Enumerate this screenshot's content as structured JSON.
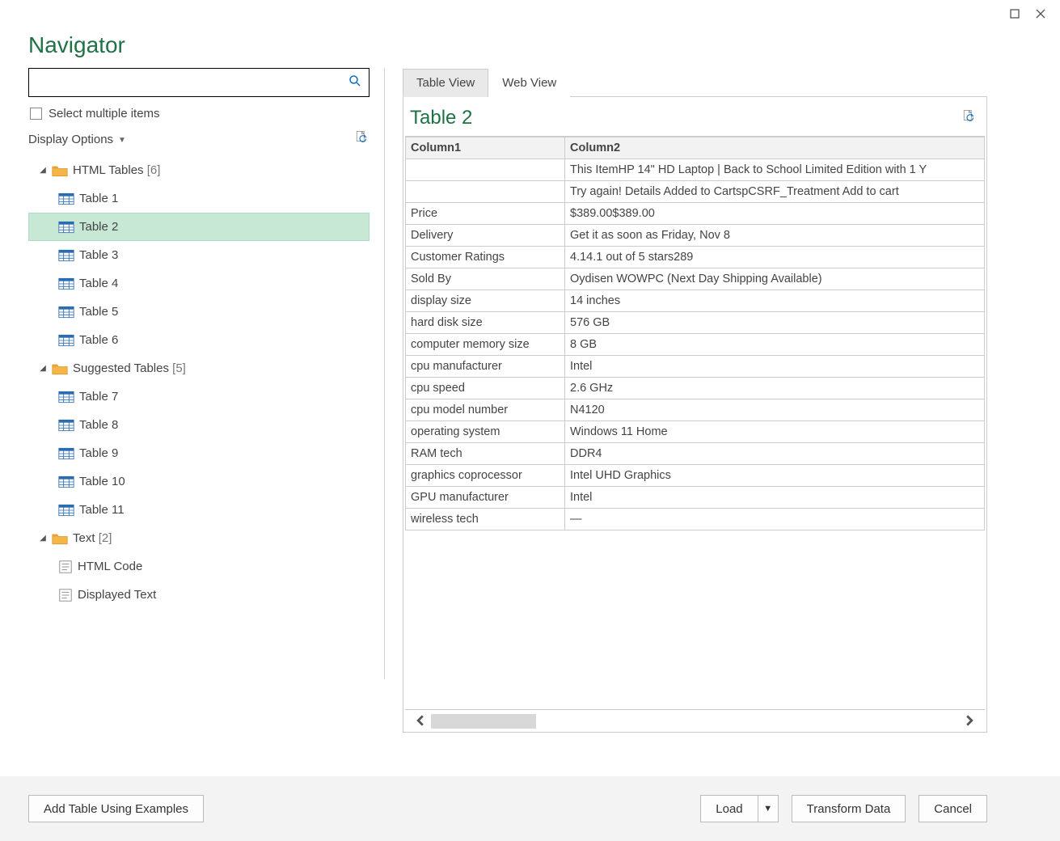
{
  "window": {
    "title": "Navigator"
  },
  "search": {
    "placeholder": ""
  },
  "select_multiple_label": "Select multiple items",
  "display_options_label": "Display Options",
  "tree": {
    "group1": {
      "label": "HTML Tables",
      "count": "[6]"
    },
    "g1items": [
      "Table 1",
      "Table 2",
      "Table 3",
      "Table 4",
      "Table 5",
      "Table 6"
    ],
    "group2": {
      "label": "Suggested Tables",
      "count": "[5]"
    },
    "g2items": [
      "Table 7",
      "Table 8",
      "Table 9",
      "Table 10",
      "Table 11"
    ],
    "group3": {
      "label": "Text",
      "count": "[2]"
    },
    "g3items": [
      "HTML Code",
      "Displayed Text"
    ],
    "selected": "Table 2"
  },
  "tabs": {
    "table_view": "Table View",
    "web_view": "Web View"
  },
  "preview": {
    "title": "Table 2",
    "headers": [
      "Column1",
      "Column2"
    ],
    "rows": [
      [
        "",
        "This ItemHP 14\" HD Laptop | Back to School Limited Edition with 1 Y"
      ],
      [
        "",
        "Try again! Details Added to CartspCSRF_Treatment Add to cart"
      ],
      [
        "Price",
        "$389.00$389.00"
      ],
      [
        "Delivery",
        "Get it as soon as Friday, Nov 8"
      ],
      [
        "Customer Ratings",
        "4.14.1 out of 5 stars289"
      ],
      [
        "Sold By",
        "Oydisen WOWPC (Next Day Shipping Available)"
      ],
      [
        "display size",
        "14 inches"
      ],
      [
        "hard disk size",
        "576 GB"
      ],
      [
        "computer memory size",
        "8 GB"
      ],
      [
        "cpu manufacturer",
        "Intel"
      ],
      [
        "cpu speed",
        "2.6 GHz"
      ],
      [
        "cpu model number",
        "N4120"
      ],
      [
        "operating system",
        "Windows 11 Home"
      ],
      [
        "RAM tech",
        "DDR4"
      ],
      [
        "graphics coprocessor",
        "Intel UHD Graphics"
      ],
      [
        "GPU manufacturer",
        "Intel"
      ],
      [
        "wireless tech",
        "—"
      ]
    ]
  },
  "footer": {
    "add_table": "Add Table Using Examples",
    "load": "Load",
    "transform": "Transform Data",
    "cancel": "Cancel"
  }
}
